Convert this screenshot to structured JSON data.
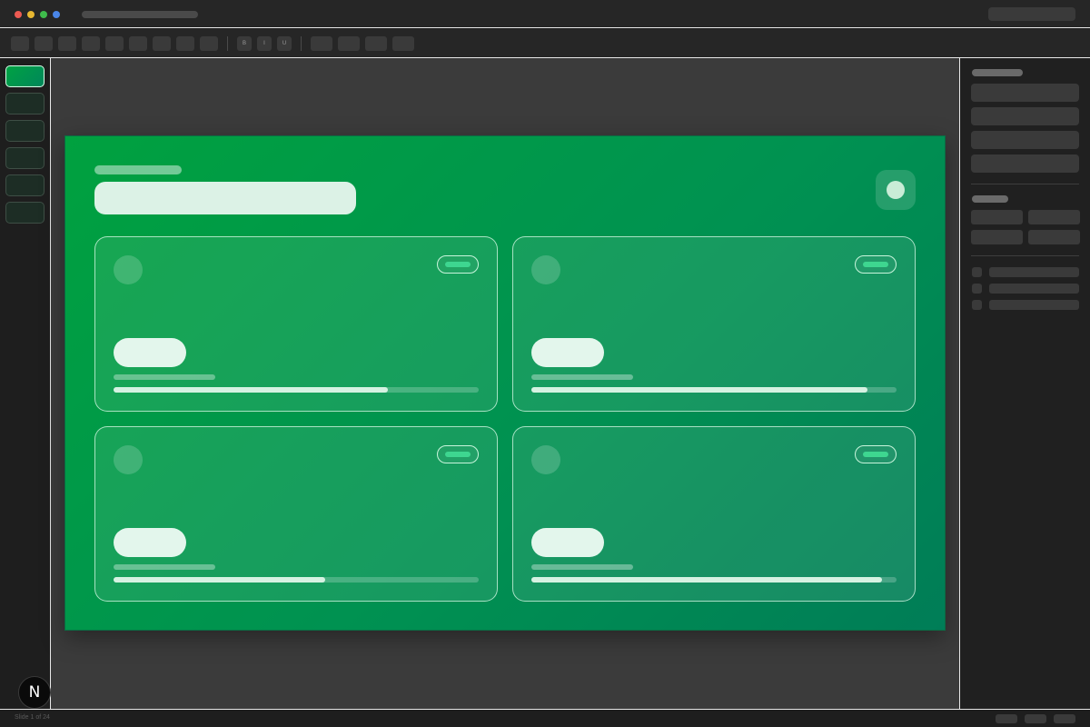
{
  "toolbar": {
    "format_buttons": [
      "B",
      "I",
      "U"
    ]
  },
  "slide": {
    "cards": [
      {
        "progress": 0.75
      },
      {
        "progress": 0.92
      },
      {
        "progress": 0.58
      },
      {
        "progress": 0.96
      }
    ]
  },
  "statusbar": {
    "slide_counter": "Slide 1 of 24"
  },
  "badge": {
    "letter": "N"
  },
  "colors": {
    "accent": "#00a243",
    "slide_gradient_end": "#007d57",
    "tag_accent": "#3ed690"
  }
}
